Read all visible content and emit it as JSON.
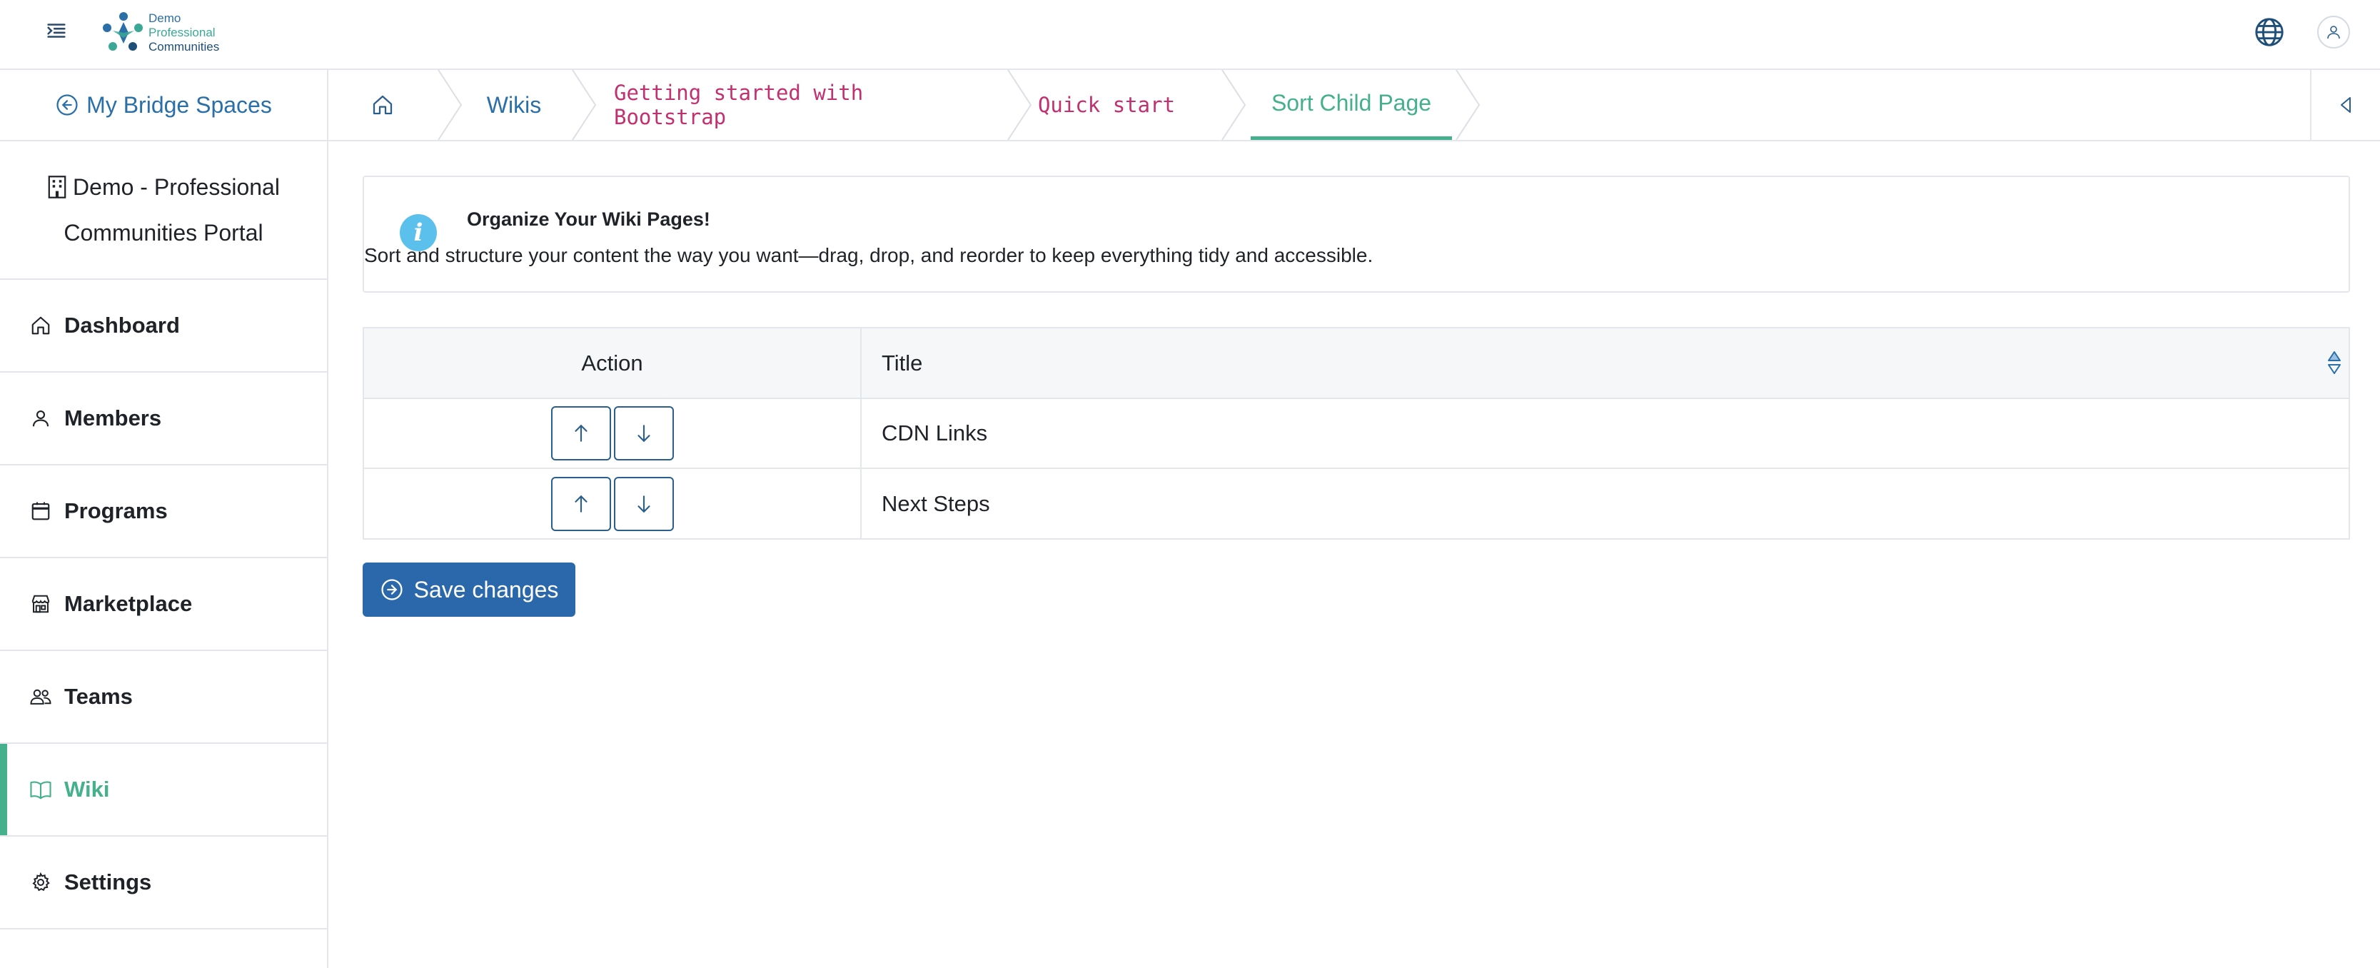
{
  "header": {
    "logo": {
      "line1": "Demo",
      "line2": "Professional",
      "line3": "Communities"
    },
    "icons": {
      "menu": "menu-toggle-icon",
      "globe": "globe-icon",
      "user": "user-icon"
    }
  },
  "sidebar": {
    "back_label": "My Bridge Spaces",
    "org_line1": "Demo - Professional",
    "org_line2": "Communities Portal",
    "items": [
      {
        "label": "Dashboard",
        "icon": "home-icon"
      },
      {
        "label": "Members",
        "icon": "person-icon"
      },
      {
        "label": "Programs",
        "icon": "calendar-icon"
      },
      {
        "label": "Marketplace",
        "icon": "store-icon"
      },
      {
        "label": "Teams",
        "icon": "people-icon"
      },
      {
        "label": "Wiki",
        "icon": "book-icon",
        "active": true
      },
      {
        "label": "Settings",
        "icon": "gear-icon"
      }
    ]
  },
  "breadcrumb": {
    "home_icon": "home-icon",
    "items": [
      "Wikis",
      "Getting started with Bootstrap",
      "Quick start",
      "Sort Child Page"
    ]
  },
  "alert": {
    "title": "Organize Your Wiki Pages!",
    "text": "Sort and structure your content the way you want—drag, drop, and reorder to keep everything tidy and accessible."
  },
  "table": {
    "headers": {
      "action": "Action",
      "title": "Title"
    },
    "rows": [
      {
        "title": "CDN Links"
      },
      {
        "title": "Next Steps"
      }
    ]
  },
  "save_button": {
    "label": "Save changes"
  },
  "colors": {
    "accent_green": "#45b08c",
    "link_blue": "#2a6fa8",
    "code_pink": "#c2306f",
    "primary_button": "#2a67ab",
    "info_icon": "#5bc0eb"
  }
}
